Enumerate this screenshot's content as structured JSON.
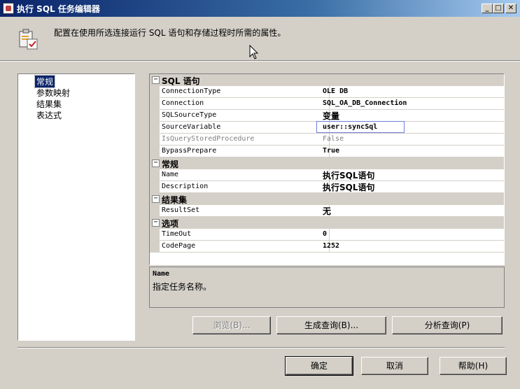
{
  "window": {
    "title": "执行 SQL 任务编辑器",
    "controls": {
      "minimize": "_",
      "maximize": "□",
      "close": "✕"
    }
  },
  "header": {
    "description": "配置在使用所选连接运行 SQL 语句和存储过程时所需的属性。",
    "icon": "task-editor-icon"
  },
  "nav": {
    "items": [
      {
        "label": "常规",
        "selected": true
      },
      {
        "label": "参数映射"
      },
      {
        "label": "结果集"
      },
      {
        "label": "表达式"
      }
    ]
  },
  "properties": {
    "categories": [
      {
        "label": "SQL 语句",
        "toggle": "⊟",
        "rows": [
          {
            "name": "ConnectionType",
            "value": "OLE DB"
          },
          {
            "name": "Connection",
            "value": "SQL_OA_DB_Connection"
          },
          {
            "name": "SQLSourceType",
            "value": "变量"
          },
          {
            "name": "SourceVariable",
            "value": "user::syncSql"
          },
          {
            "name": "IsQueryStoredProcedure",
            "value": "False"
          },
          {
            "name": "BypassPrepare",
            "value": "True"
          }
        ]
      },
      {
        "label": "常规",
        "toggle": "⊟",
        "rows": [
          {
            "name": "Name",
            "value": "执行SQL语句"
          },
          {
            "name": "Description",
            "value": "执行SQL语句"
          }
        ]
      },
      {
        "label": "结果集",
        "toggle": "⊟",
        "rows": [
          {
            "name": "ResultSet",
            "value": "无"
          }
        ]
      },
      {
        "label": "选项",
        "toggle": "⊟",
        "rows": [
          {
            "name": "TimeOut",
            "value": "0"
          },
          {
            "name": "CodePage",
            "value": "1252"
          }
        ]
      }
    ]
  },
  "description_panel": {
    "title": "Name",
    "text": "指定任务名称。"
  },
  "buttons": {
    "browse": "浏览(B)...",
    "build_query": "生成查询(B)...",
    "parse_query": "分析查询(P)",
    "ok": "确定",
    "cancel": "取消",
    "help": "帮助(H)"
  }
}
